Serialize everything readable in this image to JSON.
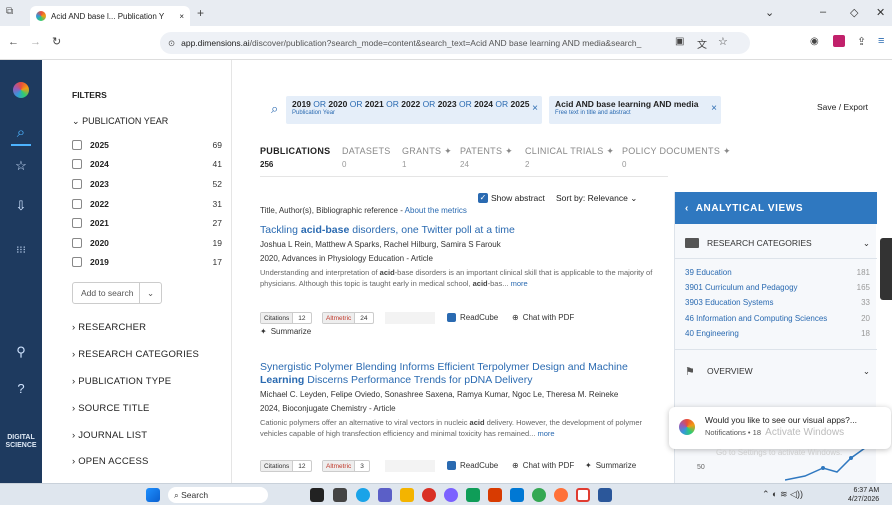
{
  "browser": {
    "tab_title": "Acid AND base l... Publication Y",
    "tab_close": "×",
    "new_tab": "+",
    "url_host": "app.dimensions.ai",
    "url_rest": "/discover/publication?search_mode=content&search_text=Acid AND base learning AND media&search_"
  },
  "filters": {
    "title": "FILTERS",
    "publication_year_label": "PUBLICATION YEAR",
    "years": [
      {
        "year": "2025",
        "count": "69"
      },
      {
        "year": "2024",
        "count": "41"
      },
      {
        "year": "2023",
        "count": "52"
      },
      {
        "year": "2022",
        "count": "31"
      },
      {
        "year": "2021",
        "count": "27"
      },
      {
        "year": "2020",
        "count": "19"
      },
      {
        "year": "2019",
        "count": "17"
      }
    ],
    "add_to_search": "Add to search",
    "sections": [
      "RESEARCHER",
      "RESEARCH CATEGORIES",
      "PUBLICATION TYPE",
      "SOURCE TITLE",
      "JOURNAL LIST",
      "OPEN ACCESS"
    ]
  },
  "rail": {
    "brand": "DIGITAL SCIENCE"
  },
  "chips": {
    "years_parts": [
      "2019",
      "OR",
      "2020",
      "OR",
      "2021",
      "OR",
      "2022",
      "OR",
      "2023",
      "OR",
      "2024",
      "OR",
      "2025"
    ],
    "years_sub": "Publication Year",
    "text_main": "Acid AND base learning AND media",
    "text_sub": "Free text in title and abstract",
    "remove": "×"
  },
  "save_export": "Save / Export",
  "result_tabs": [
    {
      "label": "PUBLICATIONS",
      "count": "256"
    },
    {
      "label": "DATASETS",
      "count": "0"
    },
    {
      "label": "GRANTS",
      "count": "1"
    },
    {
      "label": "PATENTS",
      "count": "24"
    },
    {
      "label": "CLINICAL TRIALS",
      "count": "2"
    },
    {
      "label": "POLICY DOCUMENTS",
      "count": "0"
    }
  ],
  "show_abstract": "Show abstract",
  "sort_by": "Sort by: Relevance",
  "list_header": "Title, Author(s), Bibliographic reference -",
  "about_metrics": "About the metrics",
  "results": [
    {
      "title_pre": "Tackling ",
      "title_bold": "acid-base",
      "title_post": " disorders, one Twitter poll at a time",
      "authors": "Joshua L Rein, Matthew A Sparks, Rachel Hilburg, Samira S Farouk",
      "source": "2020, Advances in Physiology Education - Article",
      "abstract_a": "Understanding and interpretation of ",
      "abstract_b": "acid",
      "abstract_c": "-base disorders is an important clinical skill that is applicable to the majority of physicians. Although this topic is taught early in medical school, ",
      "abstract_d": "acid",
      "abstract_e": "-bas...",
      "more": "more",
      "citations_label": "Citations",
      "citations": "12",
      "altmetric_label": "Altmetric",
      "altmetric": "24",
      "readcube": "ReadCube",
      "chat": "Chat with PDF",
      "summarize": "Summarize"
    },
    {
      "title_a": "Synergistic Polymer Blending Informs Efficient Terpolymer Design and Machine",
      "title_bold": "Learning",
      "title_post": " Discerns Performance Trends for pDNA Delivery",
      "authors": "Michael C. Leyden, Felipe Oviedo, Sonashree Saxena, Ramya Kumar, Ngoc Le, Theresa M. Reineke",
      "source": "2024, Bioconjugate Chemistry - Article",
      "abstract_a": "Cationic polymers offer an alternative to viral vectors in nucleic ",
      "abstract_b": "acid",
      "abstract_c": " delivery. However, the development of polymer vehicles capable of high transfection efficiency and minimal toxicity has remained...",
      "more": "more",
      "citations_label": "Citations",
      "citations": "12",
      "altmetric_label": "Altmetric",
      "altmetric": "3",
      "readcube": "ReadCube",
      "chat": "Chat with PDF",
      "summarize": "Summarize"
    }
  ],
  "analytics": {
    "header": "ANALYTICAL VIEWS",
    "research_categories": "RESEARCH CATEGORIES",
    "categories": [
      {
        "name": "39 Education",
        "count": "181"
      },
      {
        "name": "3901 Curriculum and Pedagogy",
        "count": "165"
      },
      {
        "name": "3903 Education Systems",
        "count": "33"
      },
      {
        "name": "46 Information and Computing Sciences",
        "count": "20"
      },
      {
        "name": "40 Engineering",
        "count": "18"
      }
    ],
    "overview": "OVERVIEW",
    "chart_tick": "50"
  },
  "popup": {
    "line1": "Would you like to see our visual apps?...",
    "line2": "Notifications • 18",
    "watermark1": "Activate Windows",
    "watermark2": "Go to Settings to activate Windows."
  },
  "taskbar": {
    "search": "Search",
    "time": "6:37 AM",
    "date": "4/27/2026"
  }
}
